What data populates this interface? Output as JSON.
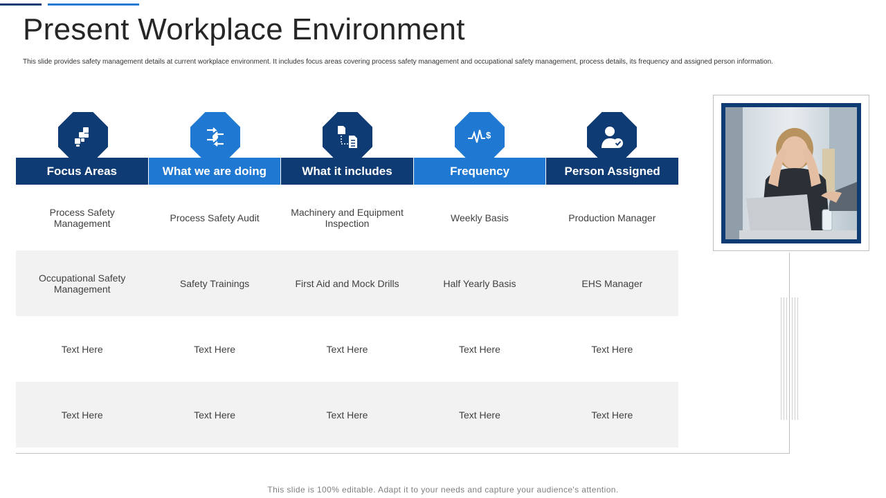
{
  "title": "Present Workplace Environment",
  "subtitle": "This slide provides safety management details at current workplace environment. It includes focus areas covering process safety management and occupational safety management, process details, its frequency and assigned person information.",
  "columns": [
    {
      "label": "Focus Areas",
      "icon": "blocks-icon",
      "color": "#0e3b73"
    },
    {
      "label": "What we are doing",
      "icon": "process-arrows-icon",
      "color": "#1f78d1"
    },
    {
      "label": "What it includes",
      "icon": "documents-icon",
      "color": "#0e3b73"
    },
    {
      "label": "Frequency",
      "icon": "pulse-dollar-icon",
      "color": "#1f78d1"
    },
    {
      "label": "Person Assigned",
      "icon": "person-check-icon",
      "color": "#0e3b73"
    }
  ],
  "rows": [
    [
      "Process Safety Management",
      "Process Safety Audit",
      "Machinery and Equipment Inspection",
      "Weekly Basis",
      "Production Manager"
    ],
    [
      "Occupational Safety Management",
      "Safety Trainings",
      "First Aid and Mock Drills",
      "Half Yearly Basis",
      "EHS  Manager"
    ],
    [
      "Text Here",
      "Text Here",
      "Text Here",
      "Text Here",
      "Text Here"
    ],
    [
      "Text Here",
      "Text Here",
      "Text Here",
      "Text Here",
      "Text Here"
    ]
  ],
  "photo": {
    "icon": "stressed-woman-photo"
  },
  "footer": "This slide is 100% editable. Adapt it to your needs and capture your audience's attention.",
  "colors": {
    "dark_blue": "#0e3b73",
    "light_blue": "#1f78d1",
    "alt_row": "#f2f2f2"
  }
}
